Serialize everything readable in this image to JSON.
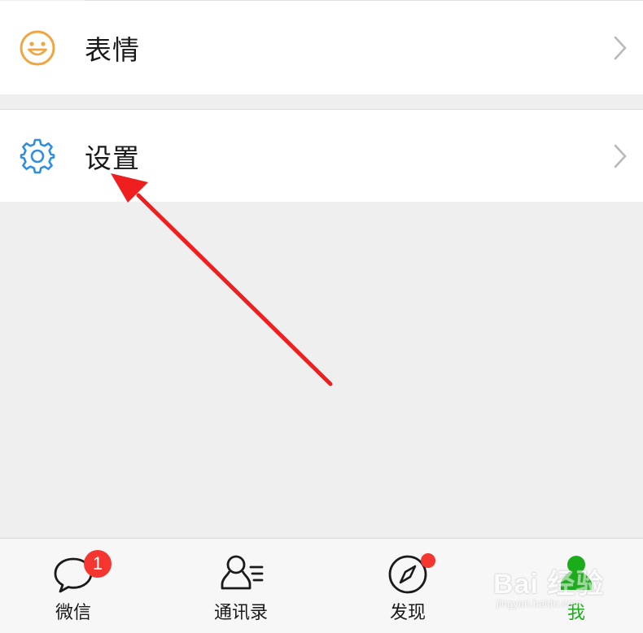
{
  "menu": {
    "items": [
      {
        "label": "表情",
        "icon": "smiley-icon",
        "icon_color": "#f0a640"
      },
      {
        "label": "设置",
        "icon": "gear-icon",
        "icon_color": "#2f8ee0"
      }
    ]
  },
  "annotation": {
    "arrow_color": "#ef1f1f",
    "points_to": "设置"
  },
  "tabbar": {
    "tabs": [
      {
        "label": "微信",
        "icon": "chat-bubble-icon",
        "badge": "1",
        "active": false
      },
      {
        "label": "通讯录",
        "icon": "contacts-icon",
        "active": false
      },
      {
        "label": "发现",
        "icon": "compass-icon",
        "red_dot": true,
        "active": false
      },
      {
        "label": "我",
        "icon": "person-icon",
        "active": true
      }
    ],
    "active_color": "#1aad19",
    "badge_color": "#f43530"
  },
  "watermark": {
    "main": "Bai 经验",
    "sub": "jingyan.baidu.com"
  }
}
